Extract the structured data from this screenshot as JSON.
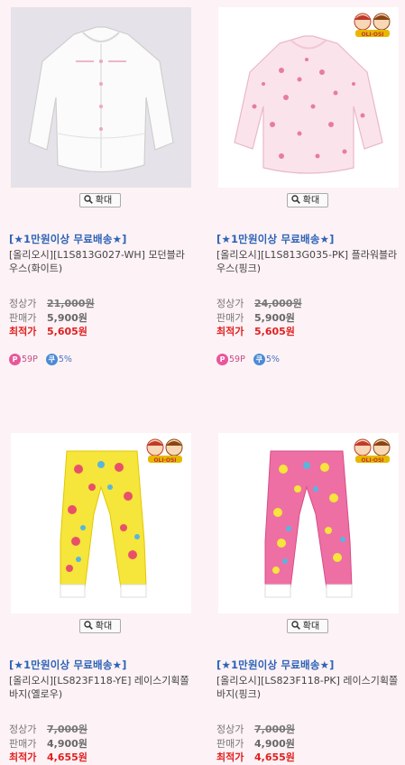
{
  "products": [
    {
      "promo": "[★1만원이상 무료배송★]",
      "name": "[올리오시][L1S813G027-WH] 모던블라우스(화이트)",
      "zoom_label": "확대",
      "price_list_label": "정상가",
      "price_list": "21,000원",
      "price_sale_label": "판매가",
      "price_sale": "5,900원",
      "price_best_label": "최적가",
      "price_best": "5,605원",
      "point_badge": "59P",
      "coupon_badge": "5%",
      "image": "white-blouse",
      "has_badges": true
    },
    {
      "promo": "[★1만원이상 무료배송★]",
      "name": "[올리오시][L1S813G035-PK] 플라워블라우스(핑크)",
      "zoom_label": "확대",
      "price_list_label": "정상가",
      "price_list": "24,000원",
      "price_sale_label": "판매가",
      "price_sale": "5,900원",
      "price_best_label": "최적가",
      "price_best": "5,605원",
      "point_badge": "59P",
      "coupon_badge": "5%",
      "image": "pink-flower-blouse",
      "has_badges": true
    },
    {
      "promo": "[★1만원이상 무료배송★]",
      "name": "[올리오시][LS823F118-YE] 레이스기획쫄바지(옐로우)",
      "zoom_label": "확대",
      "price_list_label": "정상가",
      "price_list": "7,000원",
      "price_sale_label": "판매가",
      "price_sale": "4,900원",
      "price_best_label": "최적가",
      "price_best": "4,655원",
      "image": "yellow-leggings",
      "has_badges": false
    },
    {
      "promo": "[★1만원이상 무료배송★]",
      "name": "[올리오시][LS823F118-PK] 레이스기획쫄바지(핑크)",
      "zoom_label": "확대",
      "price_list_label": "정상가",
      "price_list": "7,000원",
      "price_sale_label": "판매가",
      "price_sale": "4,900원",
      "price_best_label": "최적가",
      "price_best": "4,655원",
      "image": "pink-leggings",
      "has_badges": false
    }
  ],
  "colors": {
    "page_bg": "#fdf2f5",
    "promo": "#2c63b6",
    "best_price": "#e02020",
    "point_icon": "#e8579b",
    "coupon_icon": "#4a8bd6"
  },
  "icons": {
    "zoom": "magnifier-icon",
    "point": "point-p-icon",
    "coupon": "coupon-icon",
    "brand": "olioshi-logo"
  }
}
